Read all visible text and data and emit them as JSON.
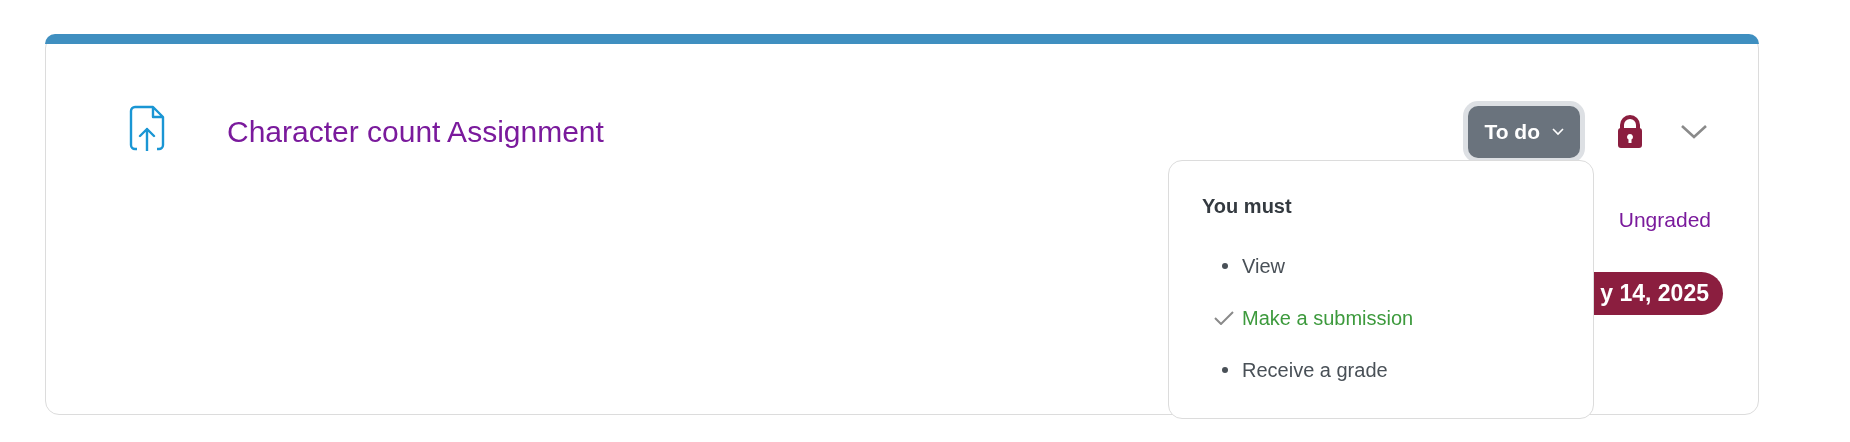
{
  "activity": {
    "title": "Character count Assignment",
    "status_button": "To do",
    "grade": "Ungraded",
    "due_date": "y 14, 2025"
  },
  "menu": {
    "heading": "You must",
    "items": [
      {
        "label": "View",
        "completed": false
      },
      {
        "label": "Make a submission",
        "completed": true
      },
      {
        "label": "Receive a grade",
        "completed": false
      }
    ]
  }
}
